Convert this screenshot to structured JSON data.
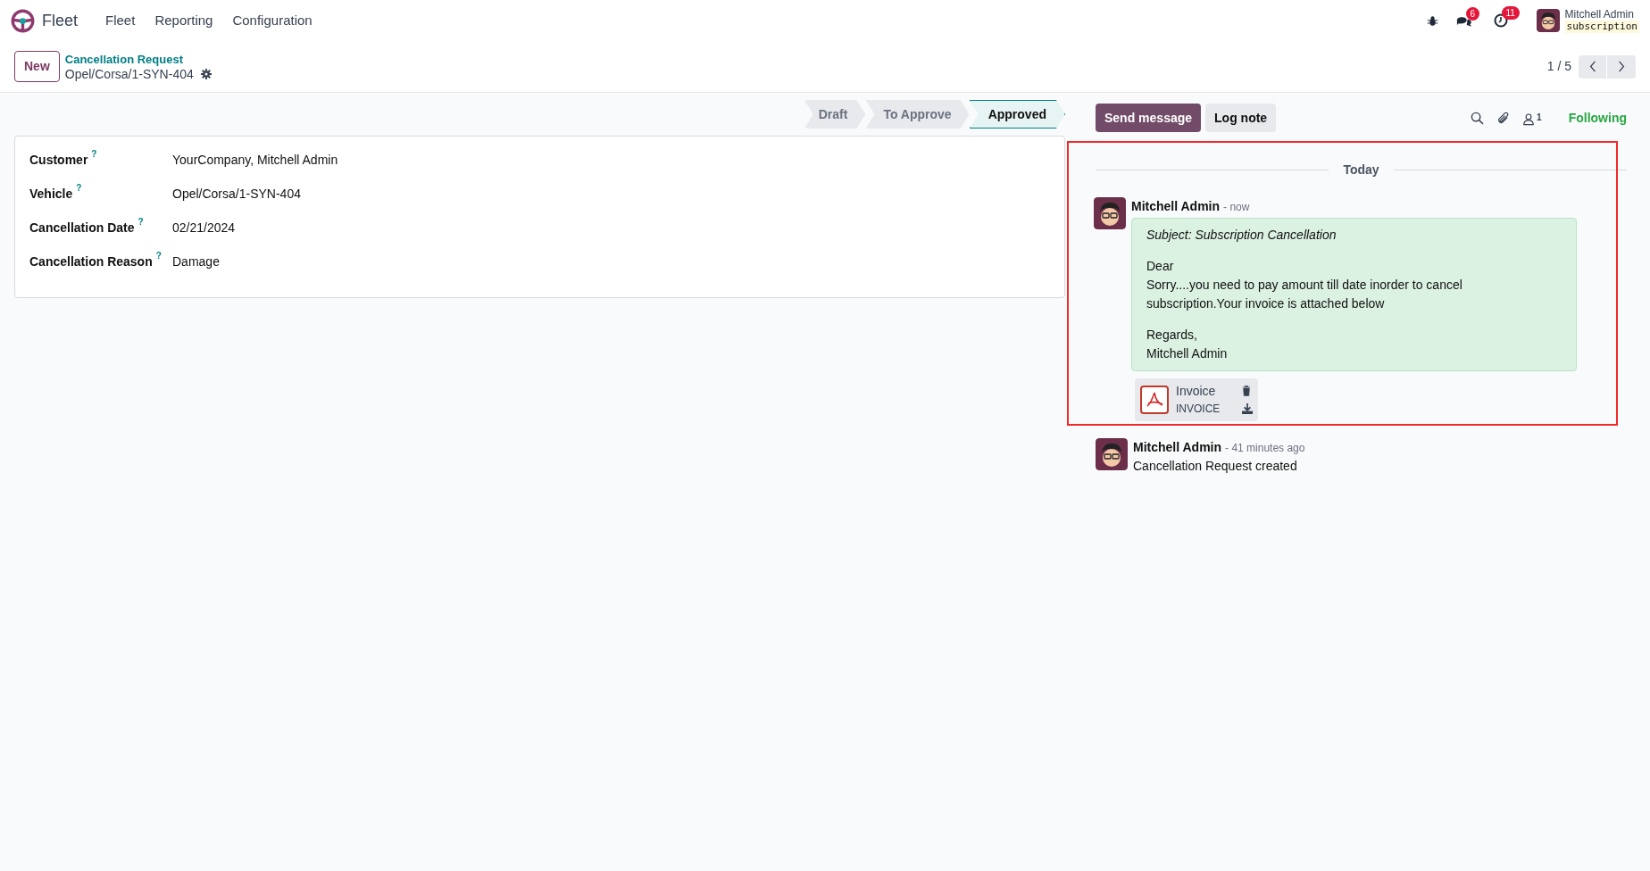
{
  "navbar": {
    "app_name": "Fleet",
    "menu": [
      "Fleet",
      "Reporting",
      "Configuration"
    ],
    "messages_badge": "6",
    "activities_badge": "11",
    "user": {
      "name": "Mitchell Admin",
      "database": "subscription"
    }
  },
  "control_panel": {
    "new_button": "New",
    "breadcrumb": "Cancellation Request",
    "record_name": "Opel/Corsa/1-SYN-404",
    "pager": "1 / 5"
  },
  "statusbar": [
    {
      "label": "Draft",
      "selected": false
    },
    {
      "label": "To Approve",
      "selected": false
    },
    {
      "label": "Approved",
      "selected": true
    }
  ],
  "form": {
    "fields": [
      {
        "label": "Customer",
        "help": "?",
        "value": "YourCompany, Mitchell Admin"
      },
      {
        "label": "Vehicle",
        "help": "?",
        "value": "Opel/Corsa/1-SYN-404"
      },
      {
        "label": "Cancellation Date",
        "help": "?",
        "value": "02/21/2024"
      },
      {
        "label": "Cancellation Reason",
        "help": "?",
        "value": "Damage"
      }
    ]
  },
  "chatter": {
    "send_message": "Send message",
    "log_note": "Log note",
    "followers_count": "1",
    "following": "Following",
    "date_separator": "Today",
    "messages": [
      {
        "kind": "email",
        "author": "Mitchell Admin",
        "time": "- now",
        "subject": "Subject: Subscription Cancellation",
        "paragraphs": [
          [
            "Dear",
            "Sorry....you need to pay amount till date inorder to cancel",
            "subscription.Your invoice is attached below"
          ],
          [
            "Regards,",
            "Mitchell Admin"
          ]
        ],
        "attachment": {
          "name": "Invoice",
          "type": "INVOICE"
        },
        "highlighted": true
      },
      {
        "kind": "notification",
        "author": "Mitchell Admin",
        "time": "- 41 minutes ago",
        "text": "Cancellation Request created",
        "highlighted": false
      }
    ]
  }
}
